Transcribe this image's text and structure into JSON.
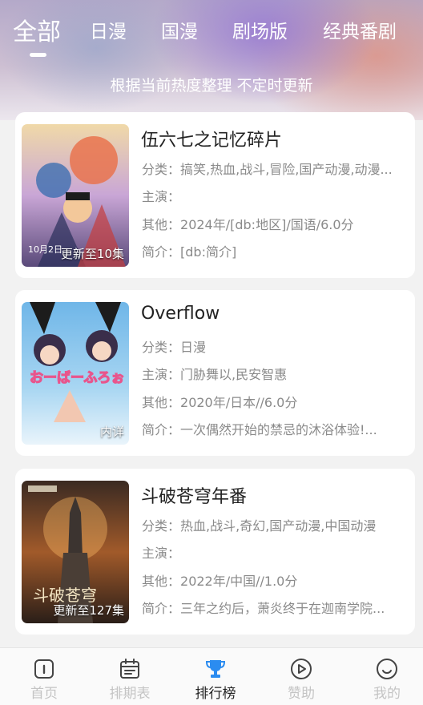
{
  "tabs": [
    "全部",
    "日漫",
    "国漫",
    "剧场版",
    "经典番剧"
  ],
  "subtitle": "根据当前热度整理 不定时更新",
  "labels": {
    "category": "分类：",
    "cast": "主演：",
    "other": "其他：",
    "intro": "简介："
  },
  "items": [
    {
      "title": "伍六七之记忆碎片",
      "badge": "更新至10集",
      "category": "搞笑,热血,战斗,冒险,国产动漫,动漫...",
      "cast": "",
      "other": "2024年/[db:地区]/国语/6.0分",
      "intro": "[db:简介]",
      "poster_text": "10月2日"
    },
    {
      "title": "Overflow",
      "badge": "内详",
      "category": "日漫",
      "cast": "门胁舞以,民安智惠",
      "other": "2020年/日本//6.0分",
      "intro": "一次偶然开始的禁忌的沐浴体验!...",
      "poster_text": "おーばーふろぉ"
    },
    {
      "title": "斗破苍穹年番",
      "badge": "更新至127集",
      "category": "热血,战斗,奇幻,国产动漫,中国动漫",
      "cast": "",
      "other": "2022年/中国//1.0分",
      "intro": "三年之约后，萧炎终于在迦南学院...",
      "poster_text": "斗破苍穹"
    }
  ],
  "nav": [
    {
      "label": "首页",
      "icon": "home-icon"
    },
    {
      "label": "排期表",
      "icon": "calendar-icon"
    },
    {
      "label": "排行榜",
      "icon": "trophy-icon"
    },
    {
      "label": "赞助",
      "icon": "play-circle-icon"
    },
    {
      "label": "我的",
      "icon": "smile-face-icon"
    }
  ],
  "colors": {
    "accent": "#2b8cf0",
    "nav_inactive": "#c4c4c4",
    "nav_active": "#222222"
  }
}
